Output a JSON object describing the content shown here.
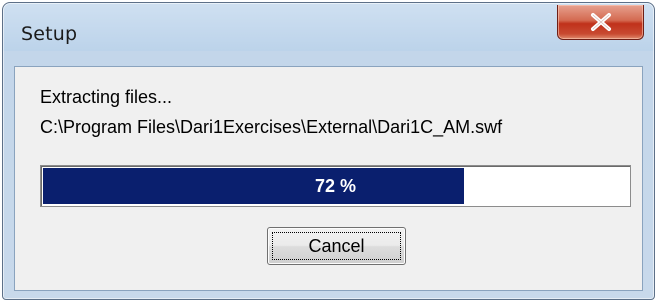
{
  "window": {
    "title": "Setup"
  },
  "title_bar": {
    "close_icon": "close-x-icon"
  },
  "status": {
    "action_text": "Extracting files...",
    "file_path": "C:\\Program Files\\Dari1Exercises\\External\\Dari1C_AM.swf"
  },
  "progress": {
    "percent": 72,
    "label": "72 %",
    "fill_color": "#0a1f6e"
  },
  "buttons": {
    "cancel_label": "Cancel"
  }
}
